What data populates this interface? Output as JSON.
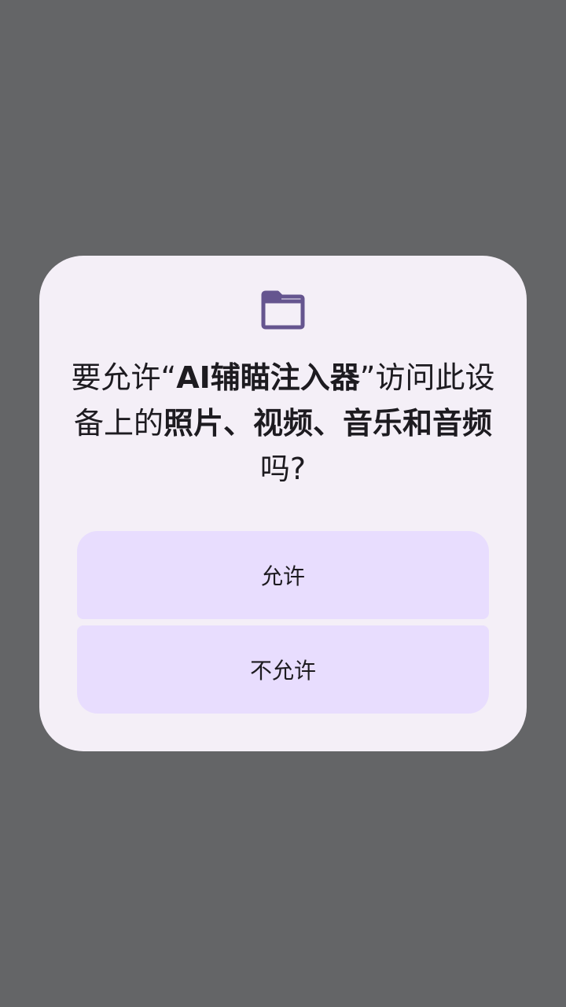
{
  "dialog": {
    "icon": "folder-icon",
    "title": {
      "prefix": "要允许“",
      "app_name": "AI辅瞄注入器",
      "middle": "”访问此设备上的",
      "media_types": "照片、视频、音乐和音频",
      "suffix": "吗?"
    },
    "allow_label": "允许",
    "deny_label": "不允许"
  },
  "colors": {
    "scrim": "#646567",
    "surface": "#f4eff7",
    "button": "#e8ddfe",
    "icon": "#65558f",
    "text": "#1d1b20"
  }
}
